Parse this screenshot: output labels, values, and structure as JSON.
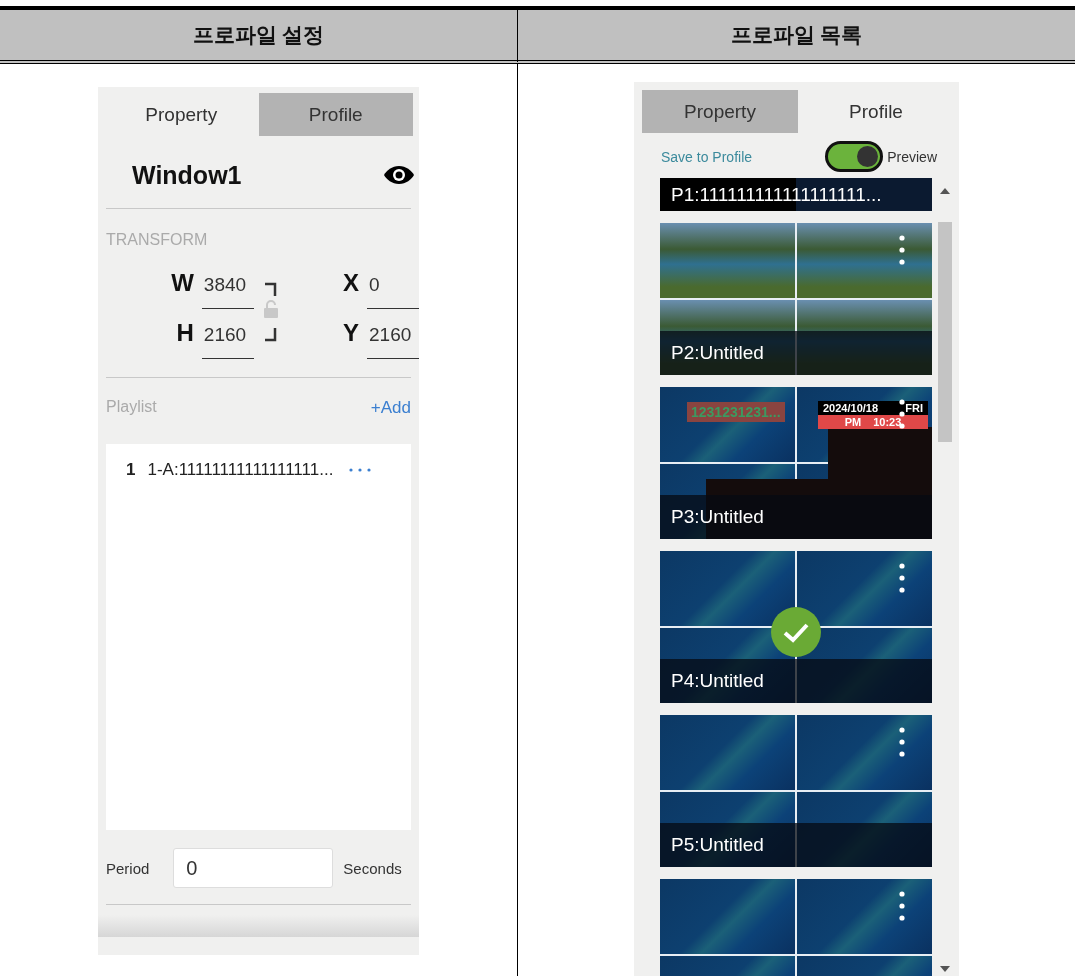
{
  "table": {
    "columns": [
      {
        "heading": "프로파일 설정"
      },
      {
        "heading": "프로파일 목록"
      }
    ]
  },
  "settings_panel": {
    "tabs": [
      {
        "label": "Property",
        "selected": true
      },
      {
        "label": "Profile",
        "selected": false
      }
    ],
    "window_name": "Window1",
    "section_title": "TRANSFORM",
    "fields": [
      {
        "label": "W",
        "value": "3840"
      },
      {
        "label": "X",
        "value": "0"
      },
      {
        "label": "H",
        "value": "2160"
      },
      {
        "label": "Y",
        "value": "2160"
      }
    ],
    "playlist_title": "Playlist",
    "add_label": "+Add",
    "playlist": [
      {
        "index": "1",
        "name": "1-A:11111111111111111..."
      }
    ],
    "period_label": "Period",
    "period_value": "0",
    "period_unit": "Seconds"
  },
  "profile_panel": {
    "tabs": [
      {
        "label": "Property",
        "selected": false
      },
      {
        "label": "Profile",
        "selected": true
      }
    ],
    "save_label": "Save to Profile",
    "preview": {
      "label": "Preview",
      "on": true
    },
    "profiles": [
      {
        "kind": "cut",
        "name": "P1:111111111111111111...",
        "selected": false
      },
      {
        "kind": "landscape",
        "name": "P2:Untitled",
        "selected": false
      },
      {
        "kind": "widgets",
        "name": "P3:Untitled",
        "selected": false,
        "ticker": "1231231231...",
        "date": "2024/10/18",
        "weekday": "FRI",
        "ampm": "PM",
        "time": "10:23"
      },
      {
        "kind": "pattern",
        "name": "P4:Untitled",
        "selected": true
      },
      {
        "kind": "pattern",
        "name": "P5:Untitled",
        "selected": false
      },
      {
        "kind": "pattern",
        "selected": false
      }
    ]
  }
}
